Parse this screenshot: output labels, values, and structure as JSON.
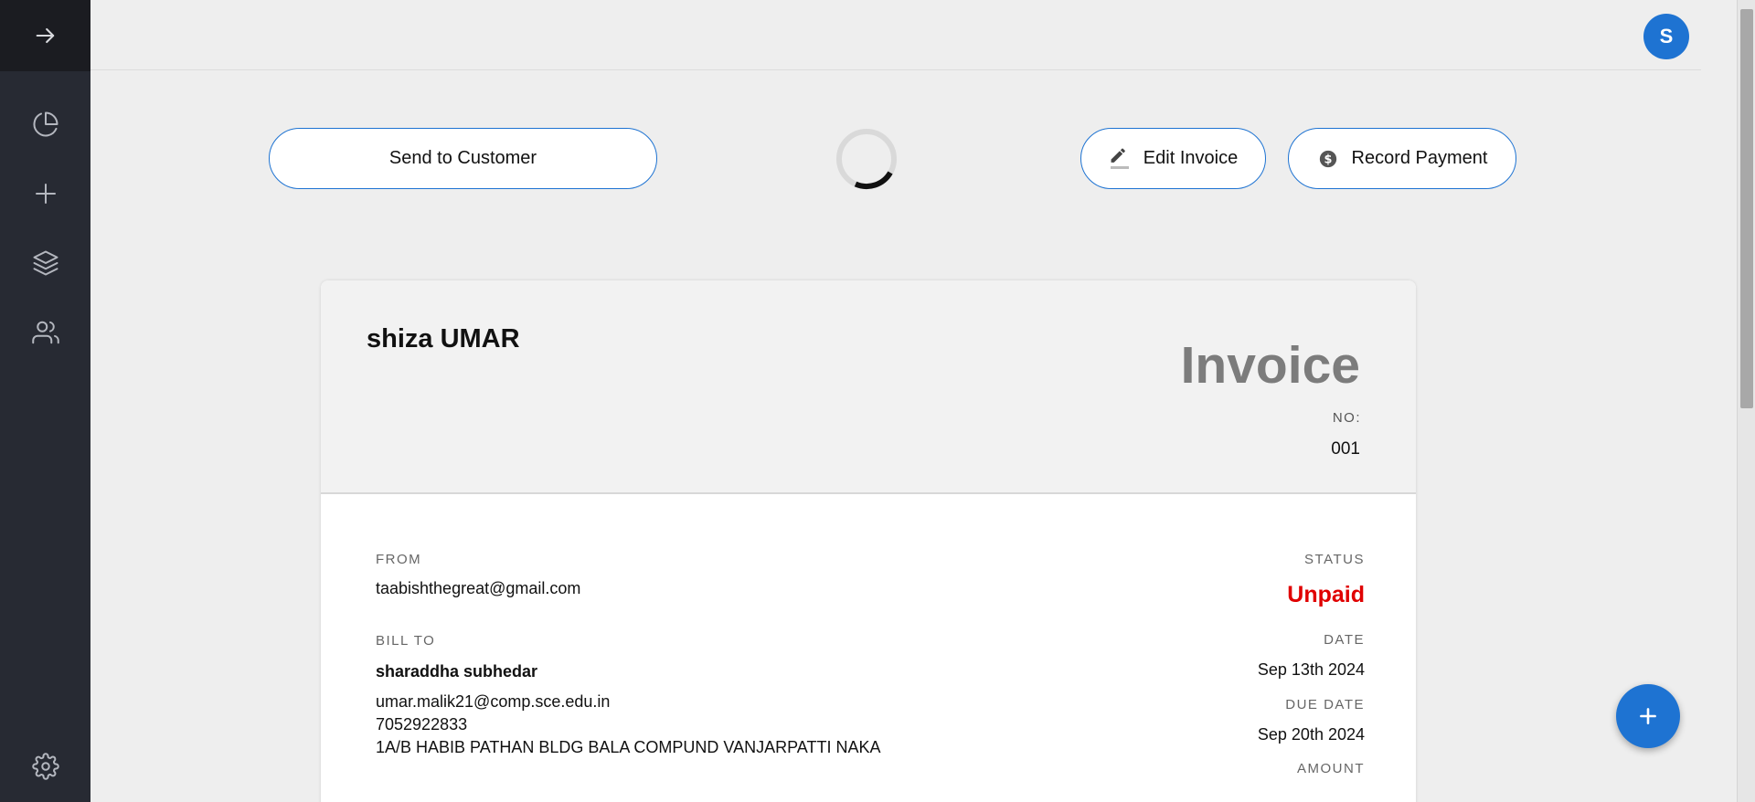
{
  "header": {
    "avatar_initial": "S"
  },
  "actions": {
    "send_label": "Send to Customer",
    "edit_label": "Edit Invoice",
    "record_label": "Record Payment"
  },
  "invoice": {
    "business_name": "shiza UMAR",
    "title": "Invoice",
    "number_label": "NO:",
    "number": "001",
    "from_label": "FROM",
    "from_email": "taabishthegreat@gmail.com",
    "bill_to_label": "BILL TO",
    "client_name": "sharaddha subhedar",
    "client_email": "umar.malik21@comp.sce.edu.in",
    "client_phone": "7052922833",
    "client_address": "1A/B HABIB PATHAN BLDG BALA COMPUND VANJARPATTI NAKA",
    "status_label": "STATUS",
    "status": "Unpaid",
    "date_label": "DATE",
    "date": "Sep 13th 2024",
    "due_date_label": "DUE DATE",
    "due_date": "Sep 20th 2024",
    "amount_label": "AMOUNT"
  },
  "colors": {
    "accent": "#1e73d2",
    "sidebar": "#272a33",
    "status_unpaid": "#e00000"
  },
  "icons": {
    "sidebar": [
      "arrow-right-icon",
      "pie-chart-icon",
      "plus-icon",
      "layers-icon",
      "users-icon",
      "settings-icon"
    ],
    "fab": "plus-icon"
  }
}
